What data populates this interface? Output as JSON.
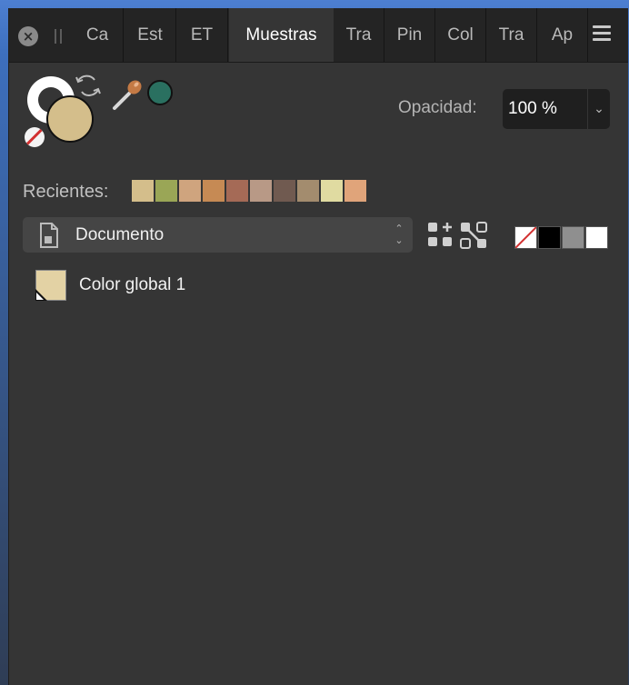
{
  "tabs": [
    {
      "label": "Ca",
      "active": false
    },
    {
      "label": "Est",
      "active": false
    },
    {
      "label": "ET",
      "active": false
    },
    {
      "label": "Muestras",
      "active": true
    },
    {
      "label": "Tra",
      "active": false
    },
    {
      "label": "Pin",
      "active": false
    },
    {
      "label": "Col",
      "active": false
    },
    {
      "label": "Tra",
      "active": false
    },
    {
      "label": "Ap",
      "active": false
    }
  ],
  "icons": {
    "close": "×",
    "stroke_ring": "stroke-ring-icon",
    "swap": "swap-arrows-icon",
    "picker": "color-picker-icon",
    "document": "document-icon",
    "add_swatch": "add-swatch-icon",
    "unlink": "unlink-icon",
    "menu": "hamburger-menu-icon",
    "dropdown_arrow": "⌄",
    "stepper_up": "⌃",
    "stepper_down": "⌄"
  },
  "colors": {
    "fill": "#d4be8b",
    "stroke": "#ffffff",
    "picked": "#2a7060"
  },
  "opacity": {
    "label": "Opacidad:",
    "value": "100 %"
  },
  "recents": {
    "label": "Recientes:",
    "swatches": [
      "#d4be8b",
      "#9aa656",
      "#cfa47e",
      "#c68a54",
      "#a56a56",
      "#b89986",
      "#705a50",
      "#a38c6e",
      "#e0dba1",
      "#e0a47a"
    ]
  },
  "palette_select": {
    "value": "Documento"
  },
  "quick_swatches": [
    "none",
    "#000000",
    "#8f8f8f",
    "#ffffff"
  ],
  "swatch_list": [
    {
      "name": "Color global 1",
      "color": "#e3d2a4"
    }
  ]
}
